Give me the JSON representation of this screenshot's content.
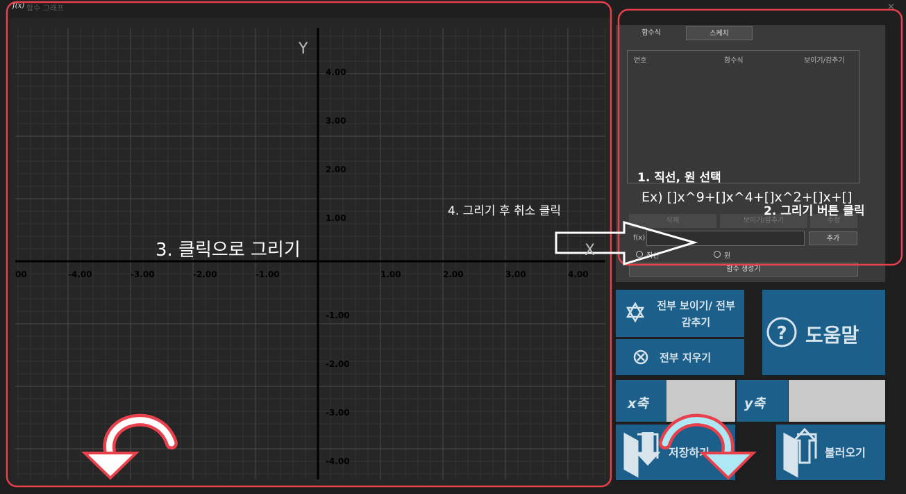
{
  "window": {
    "title": "함수 그래프",
    "icon_label": "f(x)",
    "close_label": "✕"
  },
  "graph": {
    "x_tick_labels": [
      "00",
      "-4.00",
      "-3.00",
      "-2.00",
      "-1.00",
      "1.00",
      "2.00",
      "3.00",
      "4.00"
    ],
    "y_tick_labels": [
      "4.00",
      "3.00",
      "2.00",
      "1.00",
      "-1.00",
      "-2.00",
      "-3.00",
      "-4.00"
    ],
    "x_axis_letter": "X",
    "y_axis_letter": "Y"
  },
  "panel": {
    "tabs": [
      {
        "label": "함수식"
      },
      {
        "label": "스케치"
      }
    ],
    "table_headers": [
      "번호",
      "함수식",
      "보이기/감추기"
    ],
    "buttons": {
      "delete": "삭제",
      "show_hide": "보이기/감추기",
      "edit": "수정",
      "add": "추가",
      "generate": "함수 생성기"
    },
    "fx_label": "f(x)",
    "radio": {
      "line": "직선",
      "circle": "원"
    }
  },
  "tiles": {
    "show_all": "전부 보이기/ 전부 감추기",
    "erase_all": "전부 지우기",
    "help": "도움말",
    "x_axis": "x축",
    "y_axis": "y축",
    "save": "저장하기",
    "load": "불러오기"
  },
  "annotations": {
    "step1": "1. 직선, 원 선택",
    "example": "Ex) []x^9+[]x^4+[]x^2+[]x+[]",
    "step2": "2. 그리기 버튼 클릭",
    "step3": "3. 클릭으로 그리기",
    "step4": "4. 그리기 후 취소 클릭"
  },
  "colors": {
    "annotation_outline": "#e8414b",
    "tile_blue": "#1b5f8a",
    "arrow_red": "#e8414b"
  }
}
